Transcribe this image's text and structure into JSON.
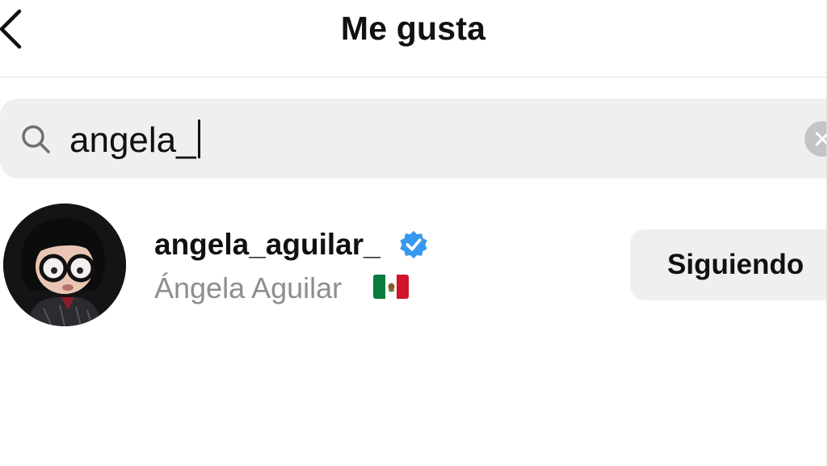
{
  "header": {
    "title": "Me gusta",
    "back_icon": "chevron-left-icon"
  },
  "search": {
    "value": "angela_",
    "icon": "search-icon",
    "clear_icon": "clear-icon"
  },
  "results": [
    {
      "username": "angela_aguilar_",
      "verified": true,
      "full_name": "Ángela Aguilar",
      "flag": "mexico-flag-icon",
      "follow_label": "Siguiendo"
    }
  ],
  "colors": {
    "verified_badge": "#3897f0",
    "secondary_text": "#8e8e8e",
    "search_bg": "#efefef"
  }
}
